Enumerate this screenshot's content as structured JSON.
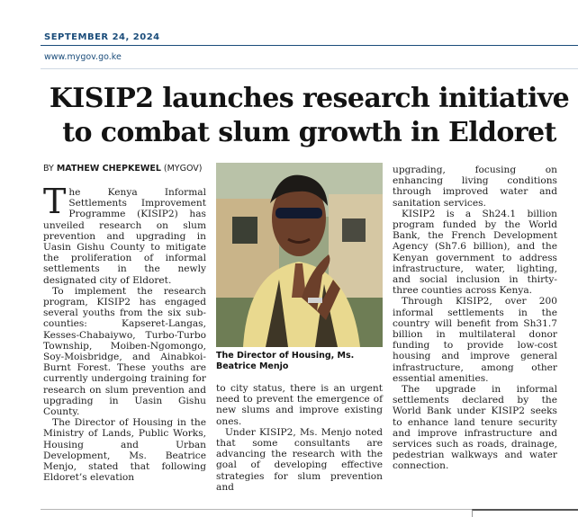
{
  "header": {
    "date": "SEPTEMBER 24, 2024",
    "url": "www.mygov.go.ke"
  },
  "article": {
    "headline_line1": "KISIP2 launches research initiative",
    "headline_line2": "to combat slum growth in Eldoret",
    "byline_prefix": "BY",
    "byline_author": "MATHEW CHEPKEWEL",
    "byline_source": "(MYGOV)",
    "dropcap": "T",
    "col1": [
      "he Kenya Informal Settlements Improvement Programme (KISIP2) has unveiled research on slum prevention and upgrading in Uasin Gishu County to mitigate the proliferation of informal settlements in the newly designated city of Eldoret.",
      "To implement the research program, KISIP2 has engaged several youths from the six sub-counties: Kapseret-Langas, Kesses-Chabaiywo, Turbo-Turbo Township, Moiben-Ngomongo, Soy-Moisbridge, and Ainabkoi-Burnt Forest. These youths are currently undergoing training for research on slum prevention and upgrading in Uasin Gishu County.",
      "The Director of Housing in the Ministry of Lands, Public Works, Housing and Urban Development, Ms. Beatrice Menjo, stated that following Eldoret’s elevation"
    ],
    "col2": [
      "to city status, there is an urgent need to prevent the emergence of new slums and improve existing ones.",
      "Under KISIP2, Ms. Menjo noted that some consultants are advancing the research with the goal of developing effective strategies for slum prevention and"
    ],
    "col3": [
      "upgrading, focusing on enhancing living conditions through improved water and sanitation services.",
      "KISIP2 is a Sh24.1 billion program funded by the World Bank, the French Development Agency (Sh7.6 billion), and the Kenyan government to address infrastructure, water, lighting, and social inclusion in thirty-three counties across Kenya.",
      "Through KISIP2, over 200 informal settlements in the country will benefit from Sh31.7 billion in multilateral donor funding to provide low-cost housing and improve general infrastructure, among other essential amenities.",
      "The upgrade in informal settlements declared by the World Bank under KISIP2 seeks to enhance land tenure security and improve infrastructure and services such as roads, drainage, pedestrian walkways and water connection."
    ],
    "photo_caption": "The Director of Housing, Ms. Beatrice Menjo"
  }
}
